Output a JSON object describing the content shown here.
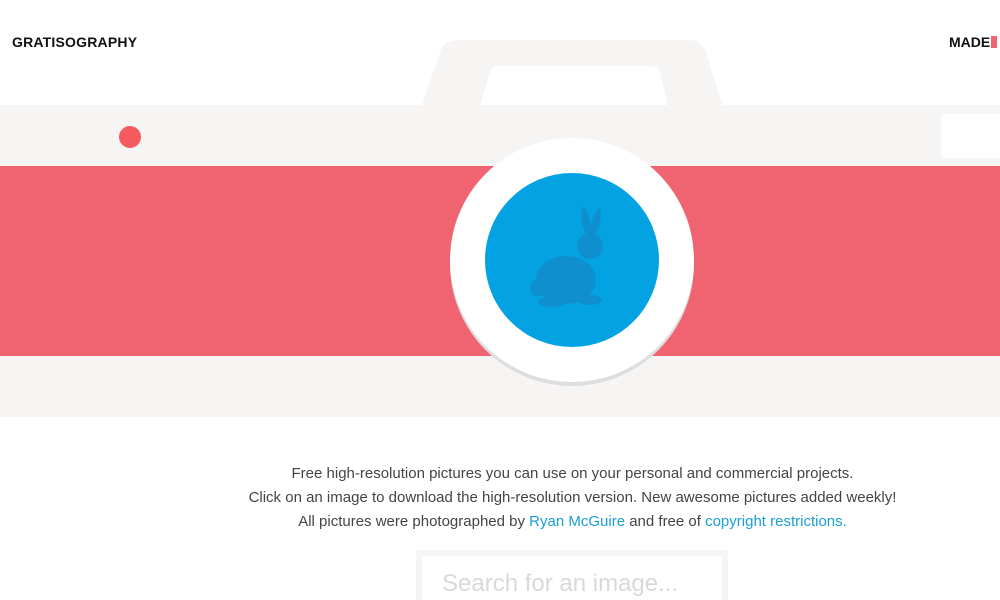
{
  "header": {
    "logo": "GRATISOGRAPHY",
    "made_label": "MADE"
  },
  "hero": {
    "lens_icon": "rabbit-icon",
    "colors": {
      "body": "#f7f4f4",
      "stripe": "#f06472",
      "lens": "#03a2e3",
      "lens_rim": "#ffffff",
      "rabbit": "#0f8fcd",
      "flash_dot": "#f55a5f"
    }
  },
  "intro": {
    "line1": "Free high-resolution pictures you can use on your personal and commercial projects.",
    "line2": "Click on an image to download the high-resolution version. New awesome pictures added weekly!",
    "line3_before": "All pictures were photographed by",
    "photographer_link": "Ryan McGuire",
    "line3_middle": "and free of",
    "copyright_link": "copyright restrictions."
  },
  "search": {
    "placeholder": "Search for an image..."
  }
}
